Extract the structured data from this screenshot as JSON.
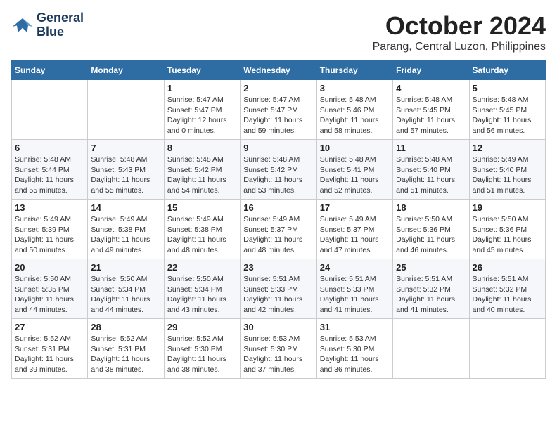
{
  "header": {
    "logo_line1": "General",
    "logo_line2": "Blue",
    "month": "October 2024",
    "location": "Parang, Central Luzon, Philippines"
  },
  "days_of_week": [
    "Sunday",
    "Monday",
    "Tuesday",
    "Wednesday",
    "Thursday",
    "Friday",
    "Saturday"
  ],
  "weeks": [
    [
      {
        "day": "",
        "sunrise": "",
        "sunset": "",
        "daylight": ""
      },
      {
        "day": "",
        "sunrise": "",
        "sunset": "",
        "daylight": ""
      },
      {
        "day": "1",
        "sunrise": "Sunrise: 5:47 AM",
        "sunset": "Sunset: 5:47 PM",
        "daylight": "Daylight: 12 hours and 0 minutes."
      },
      {
        "day": "2",
        "sunrise": "Sunrise: 5:47 AM",
        "sunset": "Sunset: 5:47 PM",
        "daylight": "Daylight: 11 hours and 59 minutes."
      },
      {
        "day": "3",
        "sunrise": "Sunrise: 5:48 AM",
        "sunset": "Sunset: 5:46 PM",
        "daylight": "Daylight: 11 hours and 58 minutes."
      },
      {
        "day": "4",
        "sunrise": "Sunrise: 5:48 AM",
        "sunset": "Sunset: 5:45 PM",
        "daylight": "Daylight: 11 hours and 57 minutes."
      },
      {
        "day": "5",
        "sunrise": "Sunrise: 5:48 AM",
        "sunset": "Sunset: 5:45 PM",
        "daylight": "Daylight: 11 hours and 56 minutes."
      }
    ],
    [
      {
        "day": "6",
        "sunrise": "Sunrise: 5:48 AM",
        "sunset": "Sunset: 5:44 PM",
        "daylight": "Daylight: 11 hours and 55 minutes."
      },
      {
        "day": "7",
        "sunrise": "Sunrise: 5:48 AM",
        "sunset": "Sunset: 5:43 PM",
        "daylight": "Daylight: 11 hours and 55 minutes."
      },
      {
        "day": "8",
        "sunrise": "Sunrise: 5:48 AM",
        "sunset": "Sunset: 5:42 PM",
        "daylight": "Daylight: 11 hours and 54 minutes."
      },
      {
        "day": "9",
        "sunrise": "Sunrise: 5:48 AM",
        "sunset": "Sunset: 5:42 PM",
        "daylight": "Daylight: 11 hours and 53 minutes."
      },
      {
        "day": "10",
        "sunrise": "Sunrise: 5:48 AM",
        "sunset": "Sunset: 5:41 PM",
        "daylight": "Daylight: 11 hours and 52 minutes."
      },
      {
        "day": "11",
        "sunrise": "Sunrise: 5:48 AM",
        "sunset": "Sunset: 5:40 PM",
        "daylight": "Daylight: 11 hours and 51 minutes."
      },
      {
        "day": "12",
        "sunrise": "Sunrise: 5:49 AM",
        "sunset": "Sunset: 5:40 PM",
        "daylight": "Daylight: 11 hours and 51 minutes."
      }
    ],
    [
      {
        "day": "13",
        "sunrise": "Sunrise: 5:49 AM",
        "sunset": "Sunset: 5:39 PM",
        "daylight": "Daylight: 11 hours and 50 minutes."
      },
      {
        "day": "14",
        "sunrise": "Sunrise: 5:49 AM",
        "sunset": "Sunset: 5:38 PM",
        "daylight": "Daylight: 11 hours and 49 minutes."
      },
      {
        "day": "15",
        "sunrise": "Sunrise: 5:49 AM",
        "sunset": "Sunset: 5:38 PM",
        "daylight": "Daylight: 11 hours and 48 minutes."
      },
      {
        "day": "16",
        "sunrise": "Sunrise: 5:49 AM",
        "sunset": "Sunset: 5:37 PM",
        "daylight": "Daylight: 11 hours and 48 minutes."
      },
      {
        "day": "17",
        "sunrise": "Sunrise: 5:49 AM",
        "sunset": "Sunset: 5:37 PM",
        "daylight": "Daylight: 11 hours and 47 minutes."
      },
      {
        "day": "18",
        "sunrise": "Sunrise: 5:50 AM",
        "sunset": "Sunset: 5:36 PM",
        "daylight": "Daylight: 11 hours and 46 minutes."
      },
      {
        "day": "19",
        "sunrise": "Sunrise: 5:50 AM",
        "sunset": "Sunset: 5:36 PM",
        "daylight": "Daylight: 11 hours and 45 minutes."
      }
    ],
    [
      {
        "day": "20",
        "sunrise": "Sunrise: 5:50 AM",
        "sunset": "Sunset: 5:35 PM",
        "daylight": "Daylight: 11 hours and 44 minutes."
      },
      {
        "day": "21",
        "sunrise": "Sunrise: 5:50 AM",
        "sunset": "Sunset: 5:34 PM",
        "daylight": "Daylight: 11 hours and 44 minutes."
      },
      {
        "day": "22",
        "sunrise": "Sunrise: 5:50 AM",
        "sunset": "Sunset: 5:34 PM",
        "daylight": "Daylight: 11 hours and 43 minutes."
      },
      {
        "day": "23",
        "sunrise": "Sunrise: 5:51 AM",
        "sunset": "Sunset: 5:33 PM",
        "daylight": "Daylight: 11 hours and 42 minutes."
      },
      {
        "day": "24",
        "sunrise": "Sunrise: 5:51 AM",
        "sunset": "Sunset: 5:33 PM",
        "daylight": "Daylight: 11 hours and 41 minutes."
      },
      {
        "day": "25",
        "sunrise": "Sunrise: 5:51 AM",
        "sunset": "Sunset: 5:32 PM",
        "daylight": "Daylight: 11 hours and 41 minutes."
      },
      {
        "day": "26",
        "sunrise": "Sunrise: 5:51 AM",
        "sunset": "Sunset: 5:32 PM",
        "daylight": "Daylight: 11 hours and 40 minutes."
      }
    ],
    [
      {
        "day": "27",
        "sunrise": "Sunrise: 5:52 AM",
        "sunset": "Sunset: 5:31 PM",
        "daylight": "Daylight: 11 hours and 39 minutes."
      },
      {
        "day": "28",
        "sunrise": "Sunrise: 5:52 AM",
        "sunset": "Sunset: 5:31 PM",
        "daylight": "Daylight: 11 hours and 38 minutes."
      },
      {
        "day": "29",
        "sunrise": "Sunrise: 5:52 AM",
        "sunset": "Sunset: 5:30 PM",
        "daylight": "Daylight: 11 hours and 38 minutes."
      },
      {
        "day": "30",
        "sunrise": "Sunrise: 5:53 AM",
        "sunset": "Sunset: 5:30 PM",
        "daylight": "Daylight: 11 hours and 37 minutes."
      },
      {
        "day": "31",
        "sunrise": "Sunrise: 5:53 AM",
        "sunset": "Sunset: 5:30 PM",
        "daylight": "Daylight: 11 hours and 36 minutes."
      },
      {
        "day": "",
        "sunrise": "",
        "sunset": "",
        "daylight": ""
      },
      {
        "day": "",
        "sunrise": "",
        "sunset": "",
        "daylight": ""
      }
    ]
  ]
}
